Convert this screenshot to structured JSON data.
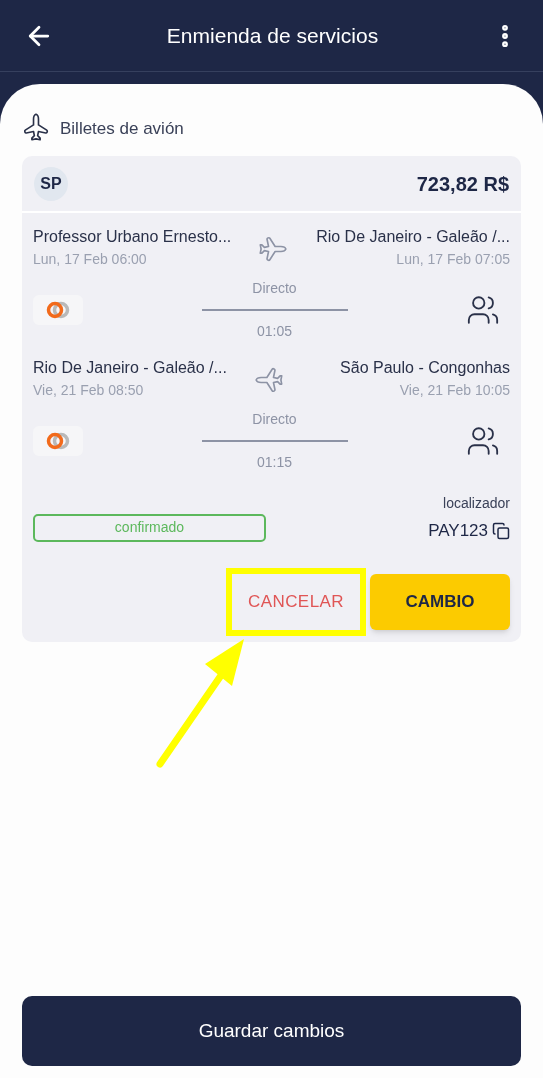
{
  "header": {
    "title": "Enmienda de servicios"
  },
  "section": {
    "title": "Billetes de avión"
  },
  "booking": {
    "initials": "SP",
    "price": "723,82 R$",
    "segments": [
      {
        "kind": "outbound",
        "from": "Professor Urbano Ernesto...",
        "from_time": "Lun, 17 Feb 06:00",
        "to": "Rio De Janeiro - Galeão /...",
        "to_time": "Lun, 17 Feb 07:05",
        "stops": "Directo",
        "duration": "01:05"
      },
      {
        "kind": "return",
        "from": "Rio De Janeiro - Galeão /...",
        "from_time": "Vie, 21 Feb 08:50",
        "to": "São Paulo - Congonhas",
        "to_time": "Vie, 21 Feb 10:05",
        "stops": "Directo",
        "duration": "01:15"
      }
    ],
    "status": "confirmado",
    "locator_label": "localizador",
    "locator": "PAY123",
    "cancel": "CANCELAR",
    "change": "CAMBIO"
  },
  "save_button": "Guardar cambios"
}
